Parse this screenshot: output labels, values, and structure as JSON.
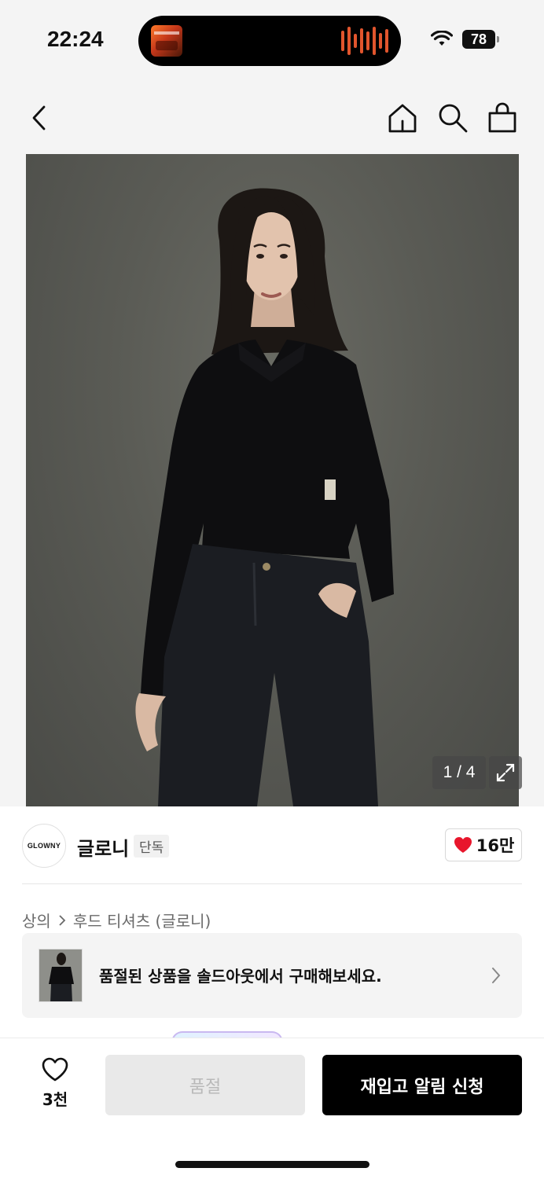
{
  "status_bar": {
    "time": "22:24",
    "battery": "78"
  },
  "nav": {
    "back_icon": "chevron-left-icon",
    "home_icon": "home-icon",
    "search_icon": "search-icon",
    "cart_icon": "shopping-bag-icon"
  },
  "gallery": {
    "page_indicator": "1 / 4",
    "expand_icon": "expand-icon"
  },
  "brand": {
    "logo_text": "GLOWNY",
    "name": "글로니",
    "tag": "단독",
    "like_count": "16만"
  },
  "breadcrumb": {
    "category": "상의",
    "subcategory": "후드 티셔츠 (글로니)"
  },
  "soldout_banner": {
    "text": "품절된 상품을 솔드아웃에서 구매해보세요."
  },
  "bottom_bar": {
    "wish_count": "3천",
    "soldout_label": "품절",
    "restock_label": "재입고 알림 신청"
  },
  "colors": {
    "accent": "#000000",
    "heart": "#e8162c",
    "background": "#f4f4f4"
  }
}
